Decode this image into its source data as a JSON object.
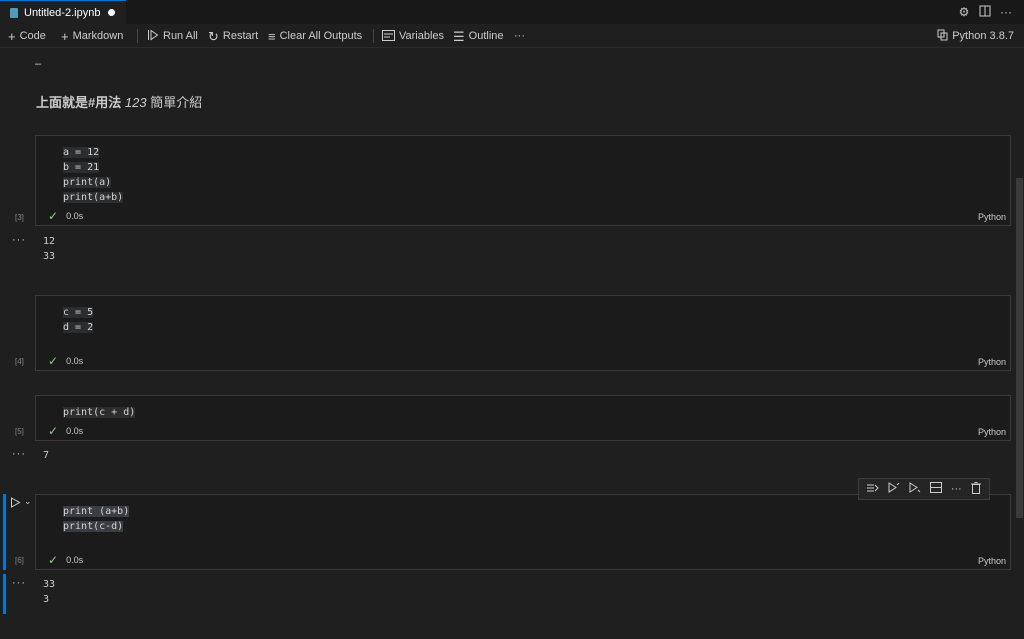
{
  "tab": {
    "title": "Untitled-2.ipynb"
  },
  "toolbar": {
    "code": "Code",
    "markdown": "Markdown",
    "run_all": "Run All",
    "restart": "Restart",
    "clear_outputs": "Clear All Outputs",
    "variables": "Variables",
    "outline": "Outline",
    "more": "···",
    "kernel": "Python 3.8.7"
  },
  "markdown_cell": {
    "dash": "–",
    "heading_bold": "上面就是#用法",
    "heading_italic": "123",
    "heading_rest": "簡單介紹"
  },
  "cells": [
    {
      "exec": "[3]",
      "lines": [
        "a = 12",
        "b = 21",
        "print(a)",
        "print(a+b)"
      ],
      "time": "0.0s",
      "lang": "Python",
      "output": [
        "12",
        "33"
      ]
    },
    {
      "exec": "[4]",
      "lines": [
        "c = 5",
        "d = 2"
      ],
      "time": "0.0s",
      "lang": "Python",
      "output": []
    },
    {
      "exec": "[5]",
      "lines": [
        "print(c + d)"
      ],
      "time": "0.0s",
      "lang": "Python",
      "output": [
        "7"
      ]
    },
    {
      "exec": "[6]",
      "lines": [
        "print (a+b)",
        "print(c-d)"
      ],
      "time": "0.0s",
      "lang": "Python",
      "output": [
        "33",
        "3"
      ]
    }
  ],
  "output_menu": "···",
  "colors": {
    "accent": "#0078d4",
    "success": "#89d185",
    "background": "#1f1f1f"
  }
}
